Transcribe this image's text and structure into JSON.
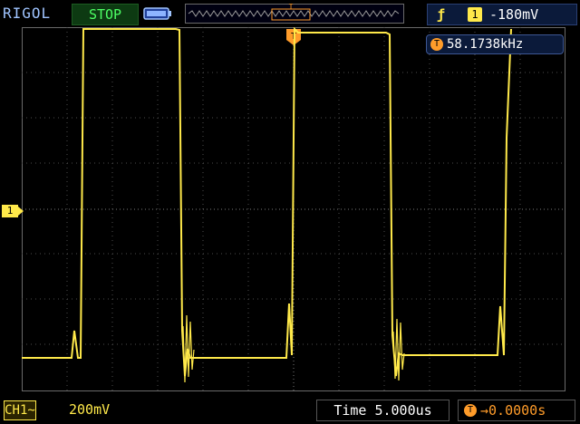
{
  "header": {
    "brand": "RIGOL",
    "run_state": "STOP",
    "trigger": {
      "edge_icon": "rising-edge-icon",
      "channel": "1",
      "level": "-180mV"
    },
    "trigger_position_marker": "T"
  },
  "measurement": {
    "icon_label": "T",
    "frequency": "58.1738kHz"
  },
  "channel_marker": "1",
  "footer": {
    "channel": "CH1",
    "coupling_icon": "ac-coupling-icon",
    "volts_per_div": "200mV",
    "timebase": "Time 5.000us",
    "trigger_offset_icon": "T",
    "trigger_offset": "→0.0000s"
  },
  "colors": {
    "trace": "#ffe94a",
    "grid": "#5a5a5a",
    "stop_text": "#4dff64",
    "brand": "#9fc4ff",
    "trigger_marker": "#ff9c2a"
  }
}
